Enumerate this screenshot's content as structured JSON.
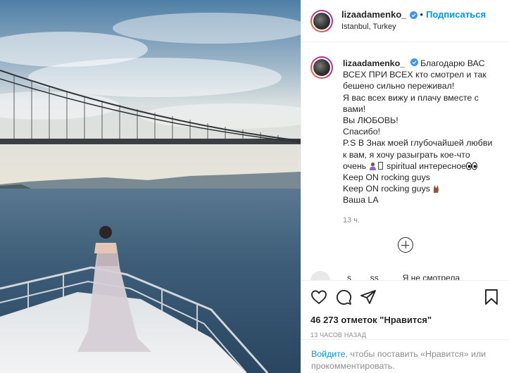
{
  "post": {
    "username": "lizaadamenko_",
    "follow_label": "Подписаться",
    "dot": "•",
    "location": "Istanbul, Turkey"
  },
  "caption": {
    "username": "lizaadamenko_",
    "lines": [
      "Благодарю ВАС",
      "ВСЕХ ПРИ ВСЕХ кто смотрел и так",
      "бешено сильно переживал!",
      "Я вас всех вижу и плачу вместе с",
      "вами!",
      "Вы ЛЮБОВЬ!",
      "Спасибо!",
      "P.S В Знак моей глубочайшей любви",
      "к вам, я хочу разыграть кое-что",
      "очень",
      "spiritual интересное",
      "Keep ON rocking guys",
      "Keep ON rocking guys",
      "Ваша LA"
    ],
    "time": "13 ч."
  },
  "comment_peek": {
    "user": "s____ss",
    "text": "Я не смотрела"
  },
  "likes": "46 273 отметок \"Нравится\"",
  "timestamp": "13 часов назад",
  "login": {
    "link": "Войдите",
    "rest": ", чтобы поставить «Нравится» или прокомментировать."
  },
  "icons": {
    "verified": "verified-badge-icon",
    "like": "heart-icon",
    "comment": "comment-bubble-icon",
    "share": "paper-plane-icon",
    "save": "bookmark-icon",
    "more_comments": "plus-circle-icon"
  },
  "colors": {
    "accent": "#0095f6",
    "text": "#262626",
    "muted": "#8e8e8e",
    "border": "#efefef"
  }
}
